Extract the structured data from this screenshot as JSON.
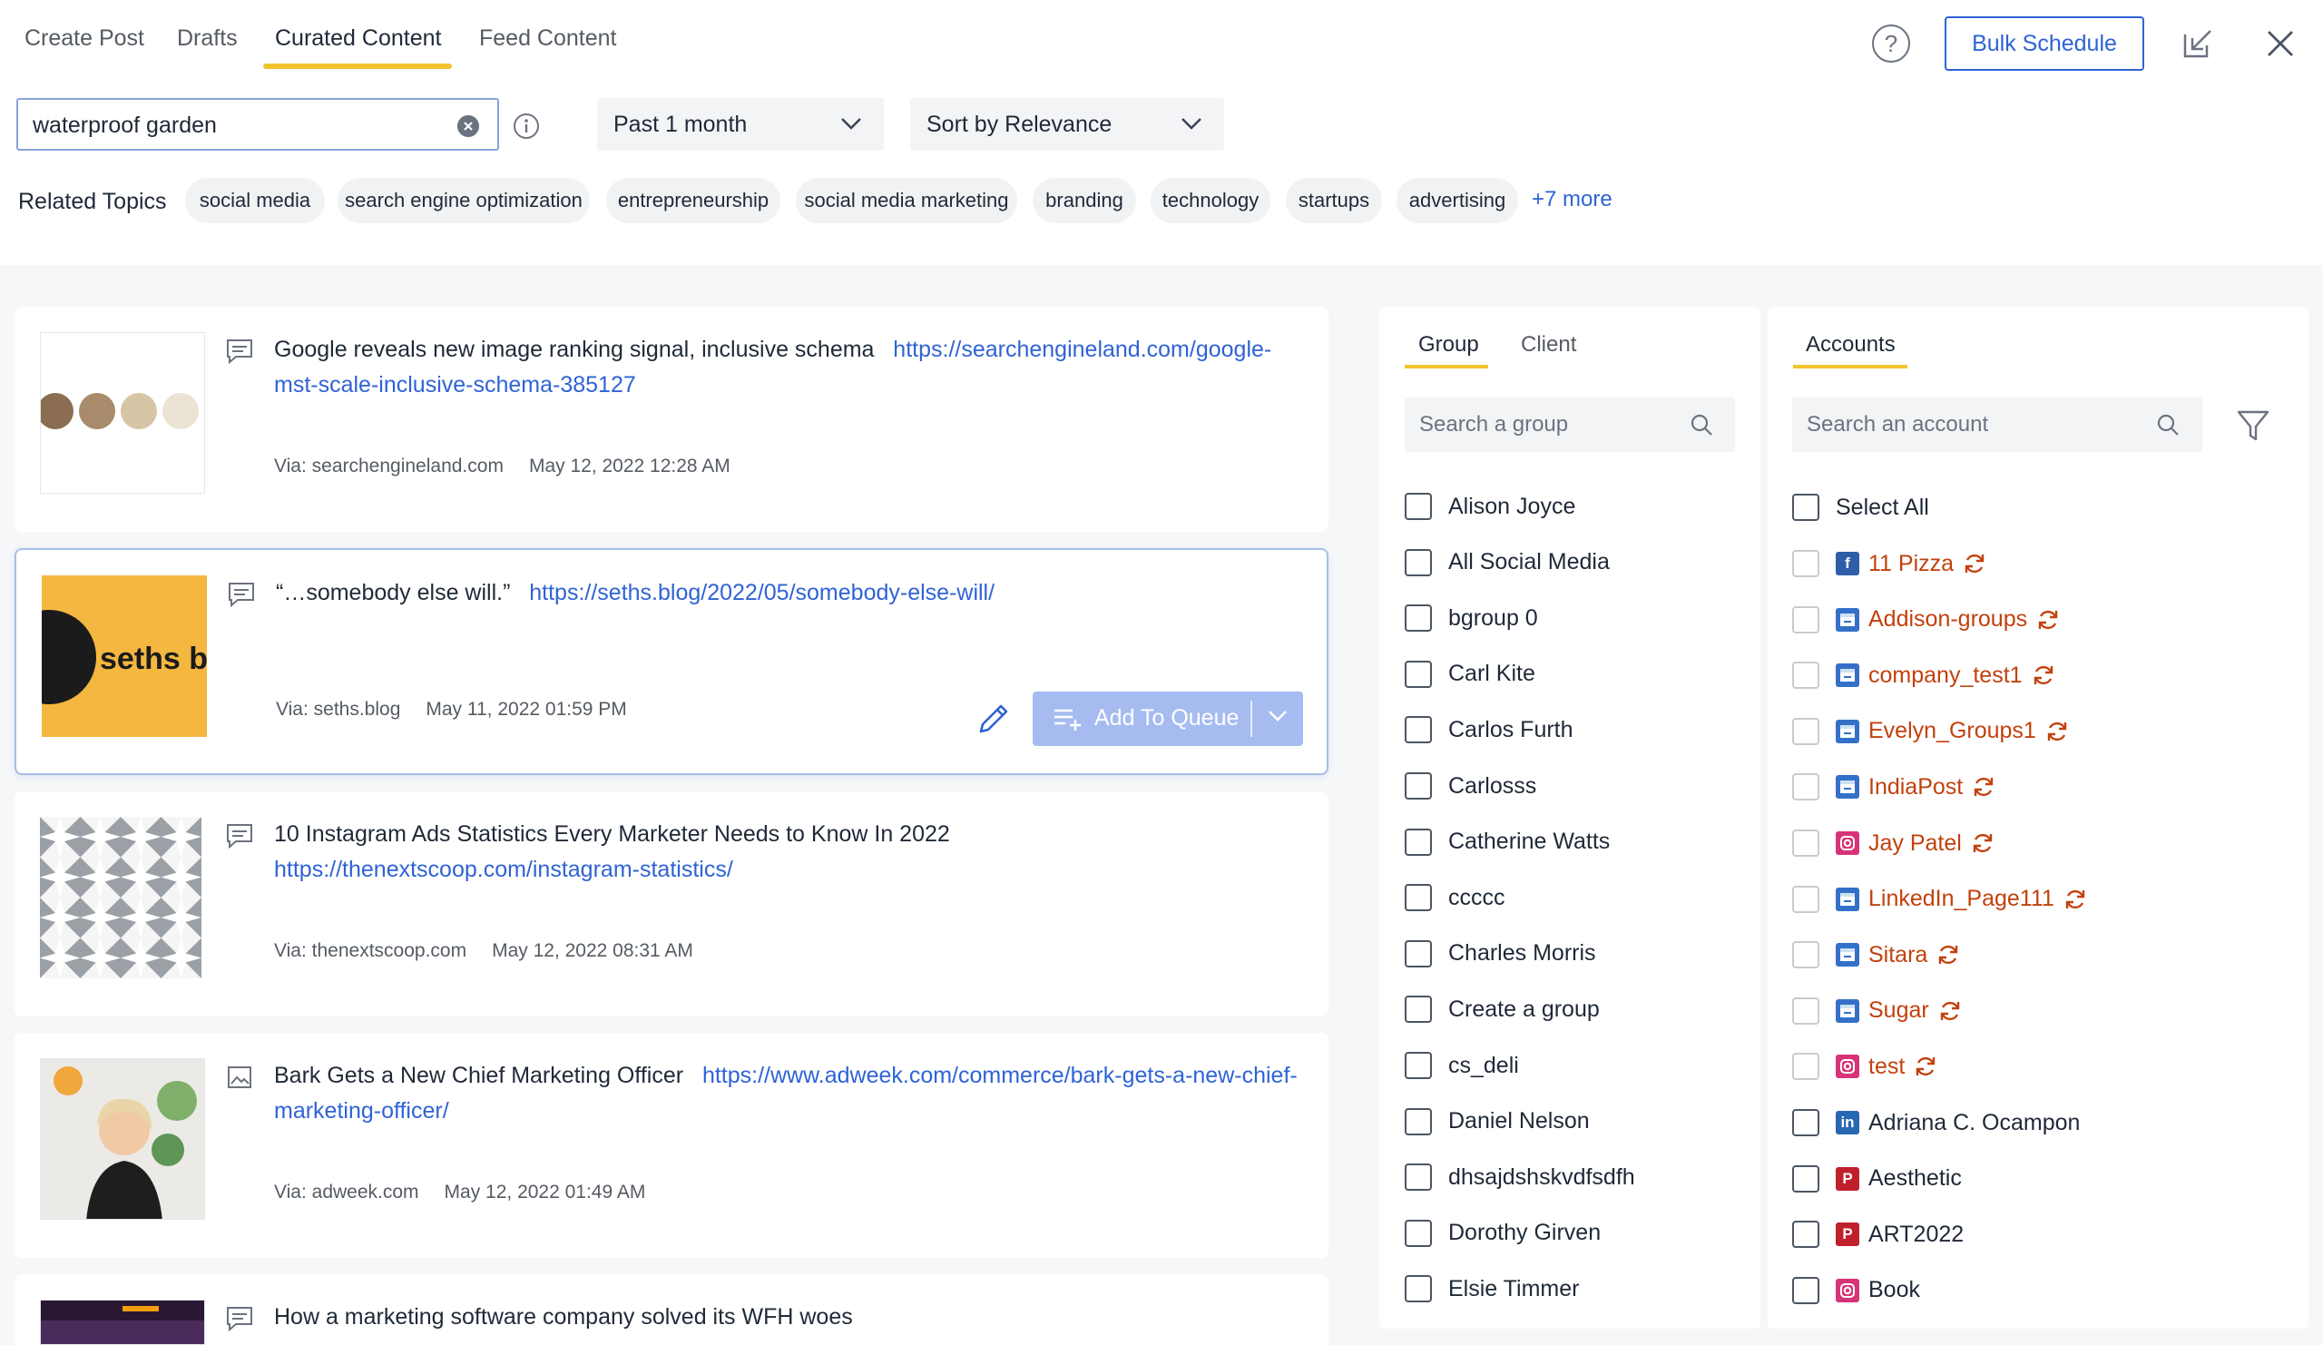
{
  "tabs": [
    {
      "label": "Create Post"
    },
    {
      "label": "Drafts"
    },
    {
      "label": "Curated Content"
    },
    {
      "label": "Feed Content"
    }
  ],
  "header": {
    "help_glyph": "?",
    "bulk_schedule_label": "Bulk Schedule"
  },
  "search": {
    "value": "waterproof garden"
  },
  "filters": {
    "date_range": "Past 1 month",
    "sort": "Sort by Relevance"
  },
  "related": {
    "label": "Related Topics",
    "topics": [
      "social media",
      "search engine optimization",
      "entrepreneurship",
      "social media marketing",
      "branding",
      "technology",
      "startups",
      "advertising"
    ],
    "more": "+7 more"
  },
  "posts": [
    {
      "title": "Google reveals new image ranking signal, inclusive schema",
      "link": "https://searchengineland.com/google-mst-scale-inclusive-schema-385127",
      "via": "Via: searchengineland.com",
      "date": "May 12, 2022 12:28 AM"
    },
    {
      "title": "“…somebody else will.”",
      "link": "https://seths.blog/2022/05/somebody-else-will/",
      "via": "Via: seths.blog",
      "date": "May 11, 2022 01:59 PM",
      "thumb_text": "seths b",
      "add_to_queue": "Add To Queue"
    },
    {
      "title": "10 Instagram Ads Statistics Every Marketer Needs to Know In 2022",
      "link": "https://thenextscoop.com/instagram-statistics/",
      "via": "Via: thenextscoop.com",
      "date": "May 12, 2022 08:31 AM"
    },
    {
      "title": "Bark Gets a New Chief Marketing Officer",
      "link": "https://www.adweek.com/commerce/bark-gets-a-new-chief-marketing-officer/",
      "via": "Via: adweek.com",
      "date": "May 12, 2022 01:49 AM"
    },
    {
      "title": "How a marketing software company solved its WFH woes",
      "link": "",
      "via": "",
      "date": ""
    }
  ],
  "groups_panel": {
    "tabs": [
      "Group",
      "Client"
    ],
    "search_placeholder": "Search a group",
    "items": [
      "Alison Joyce",
      "All Social Media",
      "bgroup 0",
      "Carl Kite",
      "Carlos Furth",
      "Carlosss",
      "Catherine Watts",
      "ccccc",
      "Charles Morris",
      "Create a group",
      "cs_deli",
      "Daniel Nelson",
      "dhsajdshskvdfsdfh",
      "Dorothy Girven",
      "Elsie Timmer"
    ]
  },
  "accounts_panel": {
    "tab": "Accounts",
    "search_placeholder": "Search an account",
    "select_all": "Select All",
    "items": [
      {
        "name": "11 Pizza",
        "platform": "facebook",
        "status": "error"
      },
      {
        "name": "Addison-groups",
        "platform": "gmb",
        "status": "error"
      },
      {
        "name": "company_test1",
        "platform": "gmb",
        "status": "error"
      },
      {
        "name": "Evelyn_Groups1",
        "platform": "gmb",
        "status": "error"
      },
      {
        "name": "IndiaPost",
        "platform": "gmb",
        "status": "error"
      },
      {
        "name": "Jay Patel",
        "platform": "instagram",
        "status": "error"
      },
      {
        "name": "LinkedIn_Page111",
        "platform": "gmb",
        "status": "error"
      },
      {
        "name": "Sitara",
        "platform": "gmb",
        "status": "error"
      },
      {
        "name": "Sugar",
        "platform": "gmb",
        "status": "error"
      },
      {
        "name": "test",
        "platform": "instagram",
        "status": "error"
      },
      {
        "name": "Adriana C. Ocampon",
        "platform": "linkedin",
        "status": "ok"
      },
      {
        "name": "Aesthetic",
        "platform": "pinterest",
        "status": "ok"
      },
      {
        "name": "ART2022",
        "platform": "pinterest",
        "status": "ok"
      },
      {
        "name": "Book",
        "platform": "instagram",
        "status": "ok"
      }
    ]
  },
  "colors": {
    "accent": "#2f63d5",
    "tab_indicator": "#f2c230",
    "error": "#c2410c",
    "facebook": "#2f5ea8",
    "gmb": "#3470c7",
    "instagram": "#d63477",
    "linkedin": "#2867b2",
    "pinterest": "#c0202b"
  }
}
